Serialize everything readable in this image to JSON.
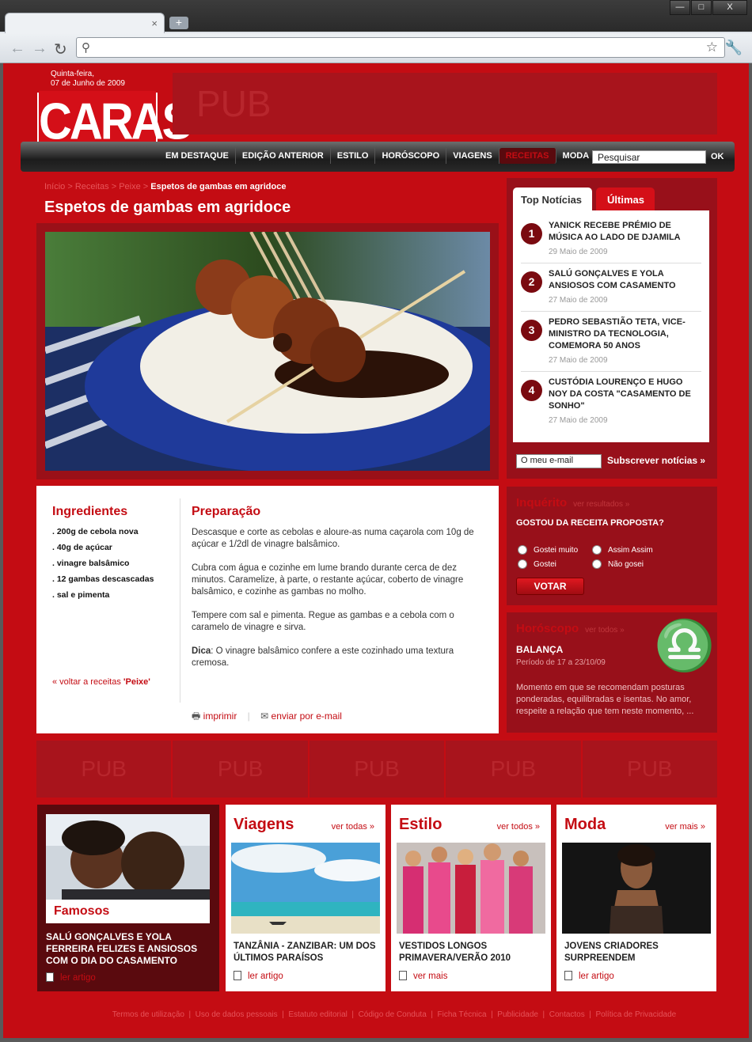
{
  "browser": {
    "window_buttons": [
      "—",
      "□",
      "X"
    ],
    "new_tab": "+",
    "close_tab": "×",
    "address": ""
  },
  "header": {
    "date_line1": "Quinta-feira,",
    "date_line2": "07 de Junho de 2009",
    "logo_text": "CARAS",
    "pub": "PUB"
  },
  "menu": {
    "items": [
      "EM DESTAQUE",
      "EDIÇÃO ANTERIOR",
      "ESTILO",
      "HORÓSCOPO",
      "VIAGENS",
      "RECEITAS",
      "MODA"
    ],
    "search_placeholder": "Pesquisar",
    "ok": "OK"
  },
  "breadcrumb": {
    "items": [
      "Início",
      "Receitas",
      "Peixe"
    ],
    "current": "Espetos de gambas em agridoce"
  },
  "article": {
    "title": "Espetos de gambas em agridoce",
    "ingredients_title": "Ingredientes",
    "ingredients": [
      ". 200g de cebola nova",
      ". 40g de açúcar",
      ". vinagre balsâmico",
      ". 12 gambas descascadas",
      ". sal e pimenta"
    ],
    "back_prefix": "« voltar a receitas ",
    "back_category": "'Peixe'",
    "preparation_title": "Preparação",
    "preparation": [
      "Descasque e corte as cebolas e aloure-as numa caçarola com 10g de açúcar e 1/2dl de vinagre balsâmico.",
      "Cubra com água e cozinhe em lume brando durante cerca de dez minutos. Caramelize, à parte, o restante açúcar, coberto de vinagre balsâmico, e cozinhe as gambas no molho.",
      "Tempere com sal e pimenta. Regue as gambas e a cebola com o caramelo de vinagre e sirva."
    ],
    "tip_label": "Dica",
    "tip_text": ": O vinagre balsâmico confere a este cozinhado uma textura cremosa.",
    "print": "imprimir",
    "email": "enviar por e-mail"
  },
  "top_news": {
    "tab_top": "Top Notícias",
    "tab_latest": "Últimas",
    "items": [
      {
        "num": "1",
        "title": "YANICK RECEBE PRÉMIO DE MÚSICA AO LADO DE DJAMILA",
        "date": "29 Maio de 2009"
      },
      {
        "num": "2",
        "title": "SALÚ GONÇALVES E YOLA ANSIOSOS COM CASAMENTO",
        "date": "27 Maio de 2009"
      },
      {
        "num": "3",
        "title": "PEDRO SEBASTIÃO TETA, VICE-MINISTRO DA TECNOLOGIA, COMEMORA 50 ANOS",
        "date": "27 Maio de 2009"
      },
      {
        "num": "4",
        "title": "CUSTÓDIA LOURENÇO E HUGO NOY DA COSTA \"CASAMENTO DE SONHO\"",
        "date": "27 Maio de 2009"
      }
    ],
    "email_placeholder": "O meu e-mail",
    "subscribe": "Subscrever notícias »"
  },
  "poll": {
    "title": "Inquérito",
    "results_link": "ver resultados »",
    "question": "GOSTOU DA RECEITA PROPOSTA?",
    "options": [
      "Gostei muito",
      "Assim Assim",
      "Gostei",
      "Não gosei"
    ],
    "vote": "VOTAR"
  },
  "horoscope": {
    "title": "Horóscopo",
    "link": "ver todos »",
    "symbol": "♎",
    "sign": "BALANÇA",
    "period": "Período de 17 a 23/10/09",
    "text": "Momento em que se recomendam posturas ponderadas, equilibradas e isentas. No amor, respeite a relação que tem neste momento, ..."
  },
  "pub_row": [
    "PUB",
    "PUB",
    "PUB",
    "PUB",
    "PUB"
  ],
  "cards": {
    "famosos": {
      "label": "Famosos",
      "caption": "SALÚ GONÇALVES E YOLA FERREIRA FELIZES E ANSIOSOS COM O DIA DO CASAMENTO",
      "link": "ler artigo"
    },
    "viagens": {
      "title": "Viagens",
      "more": "ver todas »",
      "caption": "TANZÂNIA - ZANZIBAR: UM DOS ÚLTIMOS PARAÍSOS",
      "link": "ler artigo"
    },
    "estilo": {
      "title": "Estilo",
      "more": "ver todos »",
      "caption": "VESTIDOS LONGOS PRIMAVERA/VERÃO 2010",
      "link": "ver mais"
    },
    "moda": {
      "title": "Moda",
      "more": "ver mais »",
      "caption": "JOVENS CRIADORES SURPREENDEM",
      "link": "ler artigo"
    }
  },
  "footer": {
    "links": [
      "Termos de utilização",
      "Uso de dados pessoais",
      "Estatuto editorial",
      "Código de Conduta",
      "Ficha Técnica",
      "Publicidade",
      "Contactos",
      "Política de Privacidade"
    ]
  }
}
